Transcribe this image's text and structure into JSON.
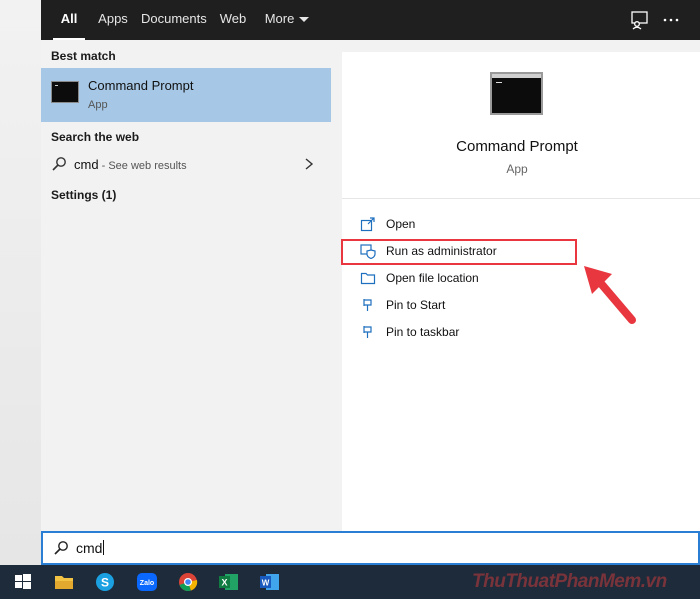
{
  "tabs": [
    {
      "label": "All",
      "active": true
    },
    {
      "label": "Apps"
    },
    {
      "label": "Documents"
    },
    {
      "label": "Web"
    },
    {
      "label": "More"
    }
  ],
  "top_icons": [
    "feedback-icon",
    "more-options-icon"
  ],
  "results": {
    "best_match_header": "Best match",
    "best_match": {
      "title": "Command Prompt",
      "subtitle": "App"
    },
    "search_web_header": "Search the web",
    "web_result": {
      "query": "cmd",
      "suffix": " - See web results"
    },
    "settings_header": "Settings (1)"
  },
  "detail": {
    "title": "Command Prompt",
    "subtitle": "App",
    "actions": [
      {
        "label": "Open",
        "icon": "open-icon"
      },
      {
        "label": "Run as administrator",
        "icon": "shield-icon"
      },
      {
        "label": "Open file location",
        "icon": "folder-icon"
      },
      {
        "label": "Pin to Start",
        "icon": "pin-icon"
      },
      {
        "label": "Pin to taskbar",
        "icon": "pin-icon"
      }
    ]
  },
  "search": {
    "value": "cmd"
  },
  "taskbar": {
    "items": [
      "windows-start-icon",
      "file-explorer-icon",
      "skype-icon",
      "zalo-icon",
      "chrome-icon",
      "excel-icon",
      "word-icon"
    ],
    "zalo_label": "Zalo"
  },
  "watermark": "ThuThuatPhanMem.vn",
  "colors": {
    "accent": "#2a7fd4",
    "selection": "#a6c8e6",
    "highlight": "#e8373f",
    "topbar": "#1f1f1f",
    "taskbar": "#1e2b3a"
  }
}
